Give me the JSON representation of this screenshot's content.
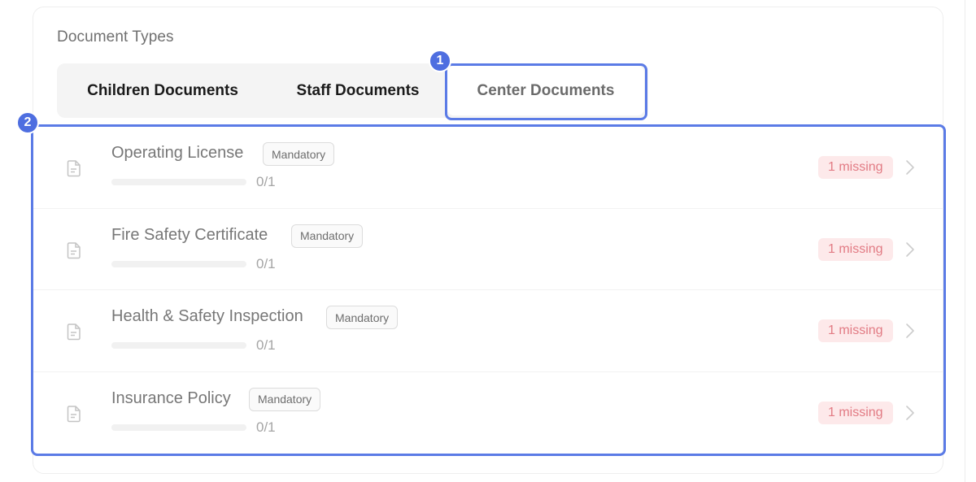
{
  "section_title": "Document Types",
  "tabs": [
    {
      "label": "Children Documents",
      "active": false
    },
    {
      "label": "Staff Documents",
      "active": false
    },
    {
      "label": "Center Documents",
      "active": true
    }
  ],
  "annotations": {
    "step1": "1",
    "step2": "2"
  },
  "documents": [
    {
      "name": "Operating License",
      "badge": "Mandatory",
      "progress": "0/1",
      "progress_fraction": 0,
      "status": "1 missing"
    },
    {
      "name": "Fire Safety Certificate",
      "badge": "Mandatory",
      "progress": "0/1",
      "progress_fraction": 0,
      "status": "1 missing"
    },
    {
      "name": "Health & Safety Inspection",
      "badge": "Mandatory",
      "progress": "0/1",
      "progress_fraction": 0,
      "status": "1 missing"
    },
    {
      "name": "Insurance Policy",
      "badge": "Mandatory",
      "progress": "0/1",
      "progress_fraction": 0,
      "status": "1 missing"
    }
  ],
  "icons": {
    "document": "document-icon",
    "chevron": "chevron-right-icon"
  },
  "colors": {
    "highlight": "#5b7be6",
    "missing_bg": "#fde9ea",
    "missing_text": "#e27b84"
  }
}
